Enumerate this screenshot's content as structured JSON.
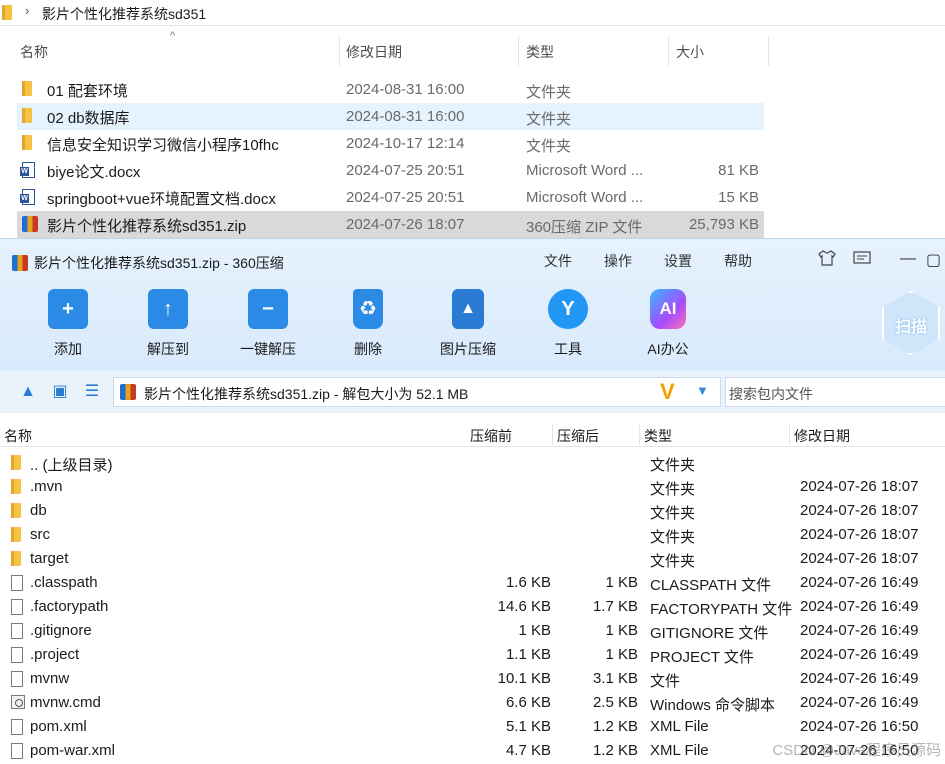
{
  "explorer": {
    "path": "影片个性化推荐系统sd351",
    "columns": {
      "name": "名称",
      "date": "修改日期",
      "type": "类型",
      "size": "大小"
    },
    "rows": [
      {
        "name": "01 配套环境",
        "date": "2024-08-31 16:00",
        "type": "文件夹",
        "size": "",
        "icon": "folder-icon"
      },
      {
        "name": "02 db数据库",
        "date": "2024-08-31 16:00",
        "type": "文件夹",
        "size": "",
        "icon": "folder-icon"
      },
      {
        "name": "信息安全知识学习微信小程序10fhc",
        "date": "2024-10-17 12:14",
        "type": "文件夹",
        "size": "",
        "icon": "folder-icon"
      },
      {
        "name": "biye论文.docx",
        "date": "2024-07-25 20:51",
        "type": "Microsoft Word ...",
        "size": "81 KB",
        "icon": "word-doc-icon"
      },
      {
        "name": "springboot+vue环境配置文档.docx",
        "date": "2024-07-25 20:51",
        "type": "Microsoft Word ...",
        "size": "15 KB",
        "icon": "word-doc-icon"
      },
      {
        "name": "影片个性化推荐系统sd351.zip",
        "date": "2024-07-26 18:07",
        "type": "360压缩 ZIP 文件",
        "size": "25,793 KB",
        "icon": "zip-archive-icon"
      }
    ]
  },
  "zip": {
    "title": "影片个性化推荐系统sd351.zip - 360压缩",
    "menu": [
      "文件",
      "操作",
      "设置",
      "帮助"
    ],
    "toolbar": [
      {
        "label": "添加",
        "glyph": "+",
        "icon": "add-icon"
      },
      {
        "label": "解压到",
        "glyph": "↑",
        "icon": "extract-icon"
      },
      {
        "label": "一键解压",
        "glyph": "−",
        "icon": "one-click-extract-icon"
      },
      {
        "label": "删除",
        "glyph": "♻",
        "icon": "delete-icon"
      },
      {
        "label": "图片压缩",
        "glyph": "▲",
        "icon": "image-compress-icon"
      },
      {
        "label": "工具",
        "glyph": "Y",
        "icon": "tools-icon"
      },
      {
        "label": "AI办公",
        "glyph": "AI",
        "icon": "ai-office-icon"
      }
    ],
    "scan_label": "扫描",
    "path_text": "影片个性化推荐系统sd351.zip - 解包大小为 52.1 MB",
    "search_placeholder": "搜索包内文件",
    "columns": {
      "name": "名称",
      "packed": "压缩前",
      "compressed": "压缩后",
      "type": "类型",
      "date": "修改日期"
    },
    "rows": [
      {
        "name": ".. (上级目录)",
        "packed": "",
        "compressed": "",
        "type": "文件夹",
        "date": "",
        "icon": "folder"
      },
      {
        "name": ".mvn",
        "packed": "",
        "compressed": "",
        "type": "文件夹",
        "date": "2024-07-26 18:07",
        "icon": "folder"
      },
      {
        "name": "db",
        "packed": "",
        "compressed": "",
        "type": "文件夹",
        "date": "2024-07-26 18:07",
        "icon": "folder"
      },
      {
        "name": "src",
        "packed": "",
        "compressed": "",
        "type": "文件夹",
        "date": "2024-07-26 18:07",
        "icon": "folder"
      },
      {
        "name": "target",
        "packed": "",
        "compressed": "",
        "type": "文件夹",
        "date": "2024-07-26 18:07",
        "icon": "folder"
      },
      {
        "name": ".classpath",
        "packed": "1.6 KB",
        "compressed": "1 KB",
        "type": "CLASSPATH 文件",
        "date": "2024-07-26 16:49",
        "icon": "file"
      },
      {
        "name": ".factorypath",
        "packed": "14.6 KB",
        "compressed": "1.7 KB",
        "type": "FACTORYPATH 文件",
        "date": "2024-07-26 16:49",
        "icon": "file"
      },
      {
        "name": ".gitignore",
        "packed": "1 KB",
        "compressed": "1 KB",
        "type": "GITIGNORE 文件",
        "date": "2024-07-26 16:49",
        "icon": "file"
      },
      {
        "name": ".project",
        "packed": "1.1 KB",
        "compressed": "1 KB",
        "type": "PROJECT 文件",
        "date": "2024-07-26 16:49",
        "icon": "file"
      },
      {
        "name": "mvnw",
        "packed": "10.1 KB",
        "compressed": "3.1 KB",
        "type": "文件",
        "date": "2024-07-26 16:49",
        "icon": "file"
      },
      {
        "name": "mvnw.cmd",
        "packed": "6.6 KB",
        "compressed": "2.5 KB",
        "type": "Windows 命令脚本",
        "date": "2024-07-26 16:49",
        "icon": "cmd"
      },
      {
        "name": "pom.xml",
        "packed": "5.1 KB",
        "compressed": "1.2 KB",
        "type": "XML File",
        "date": "2024-07-26 16:50",
        "icon": "file"
      },
      {
        "name": "pom-war.xml",
        "packed": "4.7 KB",
        "compressed": "1.2 KB",
        "type": "XML File",
        "date": "2024-07-26 16:50",
        "icon": "file"
      }
    ]
  },
  "watermark": "CSDN @Java程序员源码"
}
